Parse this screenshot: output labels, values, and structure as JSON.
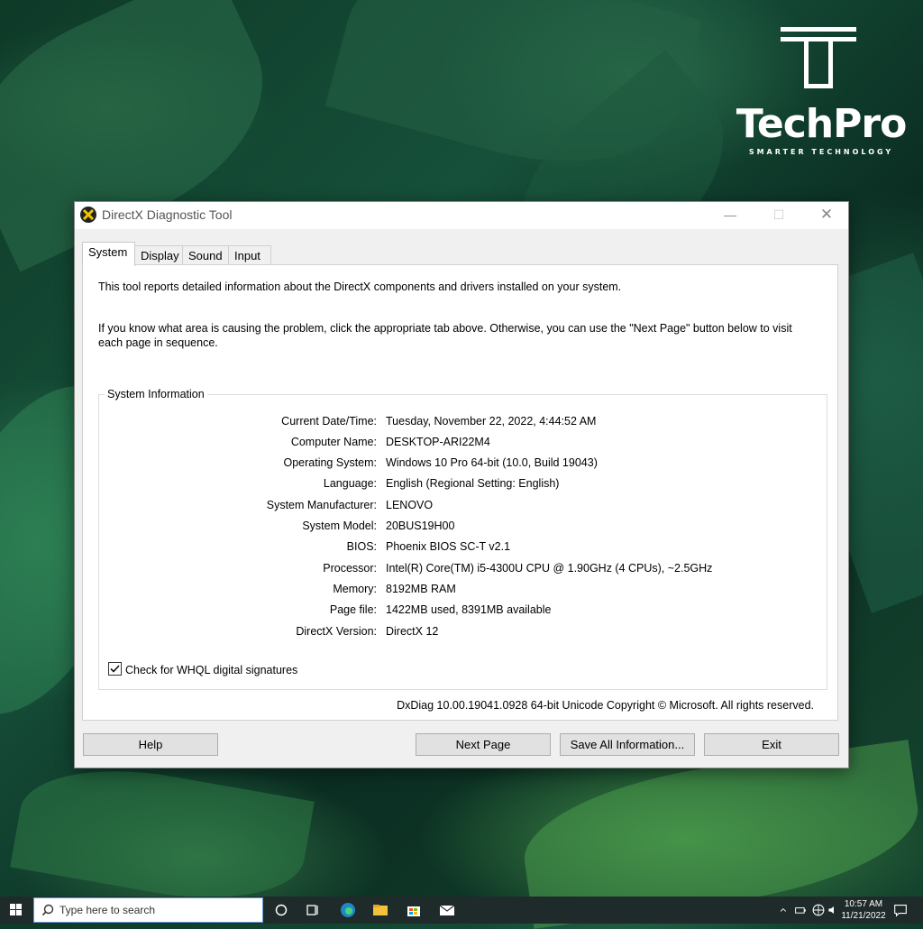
{
  "brand": {
    "name": "TechPro",
    "tagline": "SMARTER TECHNOLOGY"
  },
  "window": {
    "title": "DirectX Diagnostic Tool",
    "controls": {
      "minimize": "—",
      "maximize": "☐",
      "close": "✕"
    }
  },
  "tabs": [
    {
      "label": "System",
      "active": true
    },
    {
      "label": "Display",
      "active": false
    },
    {
      "label": "Sound",
      "active": false
    },
    {
      "label": "Input",
      "active": false
    }
  ],
  "intro": {
    "line1": "This tool reports detailed information about the DirectX components and drivers installed on your system.",
    "line2": "If you know what area is causing the problem, click the appropriate tab above.  Otherwise, you can use the \"Next Page\" button below to visit each page in sequence."
  },
  "system_info": {
    "title": "System Information",
    "rows": [
      {
        "label": "Current Date/Time:",
        "value": "Tuesday, November 22, 2022, 4:44:52 AM"
      },
      {
        "label": "Computer Name:",
        "value": "DESKTOP-ARI22M4"
      },
      {
        "label": "Operating System:",
        "value": "Windows 10 Pro 64-bit (10.0, Build 19043)"
      },
      {
        "label": "Language:",
        "value": "English (Regional Setting: English)"
      },
      {
        "label": "System Manufacturer:",
        "value": "LENOVO"
      },
      {
        "label": "System Model:",
        "value": "20BUS19H00"
      },
      {
        "label": "BIOS:",
        "value": "Phoenix BIOS SC-T v2.1"
      },
      {
        "label": "Processor:",
        "value": "Intel(R) Core(TM) i5-4300U CPU @ 1.90GHz (4 CPUs), ~2.5GHz"
      },
      {
        "label": "Memory:",
        "value": "8192MB RAM"
      },
      {
        "label": "Page file:",
        "value": "1422MB used, 8391MB available"
      },
      {
        "label": "DirectX Version:",
        "value": "DirectX 12"
      }
    ],
    "whql_label": "Check for WHQL digital signatures",
    "whql_checked": true
  },
  "footer": "DxDiag 10.00.19041.0928 64-bit Unicode  Copyright © Microsoft. All rights reserved.",
  "buttons": {
    "help": "Help",
    "next_page": "Next Page",
    "save_all": "Save All Information...",
    "exit": "Exit"
  },
  "taskbar": {
    "search_placeholder": "Type here to search",
    "time": "10:57 AM",
    "date": "11/21/2022"
  },
  "colors": {
    "taskbar": "#1f2a2a",
    "window_bg": "#f0f0f0",
    "button_bg": "#e1e1e1"
  }
}
